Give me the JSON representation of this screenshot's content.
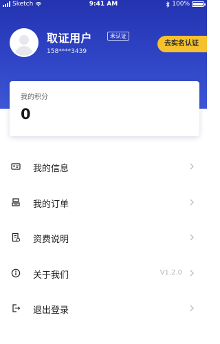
{
  "status_bar": {
    "carrier": "Sketch",
    "time": "9:41 AM",
    "battery": "100%"
  },
  "profile": {
    "name": "取证用户",
    "verify_status": "未认证",
    "phone": "158****3439",
    "realname_button": "去实名认证"
  },
  "points": {
    "label": "我的积分",
    "value": "0"
  },
  "menu": {
    "items": [
      {
        "label": "我的信息",
        "icon": "id-card-icon"
      },
      {
        "label": "我的订单",
        "icon": "order-icon"
      },
      {
        "label": "资费说明",
        "icon": "pricing-doc-icon"
      },
      {
        "label": "关于我们",
        "icon": "info-icon",
        "version": "V1.2.0"
      },
      {
        "label": "退出登录",
        "icon": "logout-icon"
      }
    ]
  },
  "colors": {
    "header_start": "#2433b0",
    "header_end": "#3d57d6",
    "accent_button": "#f5c12e"
  }
}
